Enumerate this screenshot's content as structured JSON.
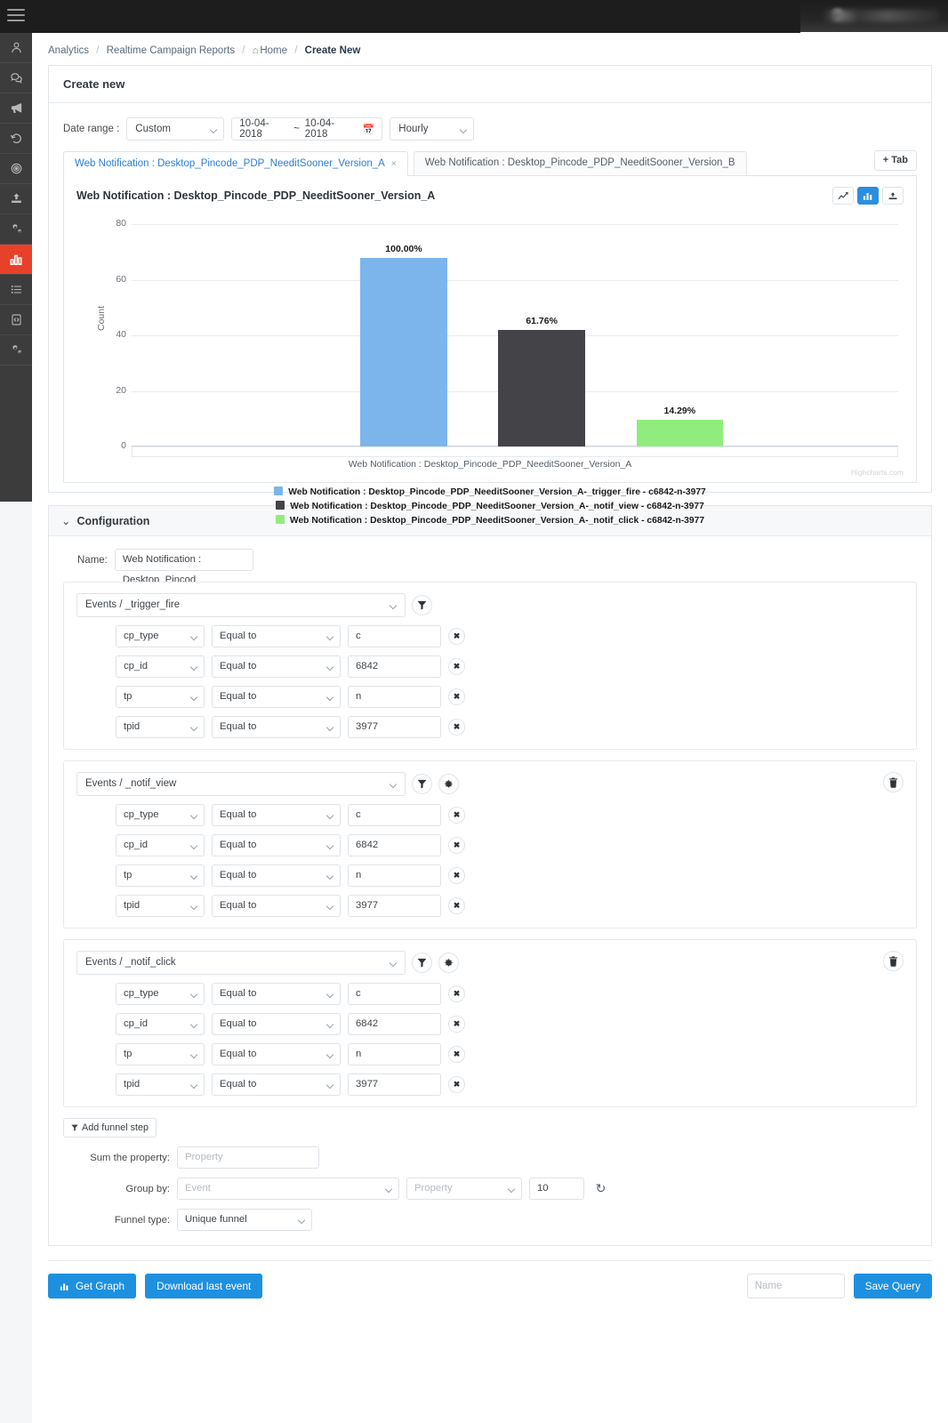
{
  "topbar": {
    "menu_icon": "hamburger-menu-icon",
    "user_area": "user-account-blurred"
  },
  "sidebar": {
    "items": [
      {
        "icon": "user-icon",
        "name": "users",
        "active": false
      },
      {
        "icon": "chat-icon",
        "name": "messages",
        "active": false
      },
      {
        "icon": "megaphone-icon",
        "name": "campaigns",
        "active": false
      },
      {
        "icon": "history-icon",
        "name": "history",
        "active": false
      },
      {
        "icon": "target-icon",
        "name": "targeting",
        "active": false
      },
      {
        "icon": "upload-icon",
        "name": "upload",
        "active": false
      },
      {
        "icon": "gears-icon",
        "name": "settings",
        "active": false
      },
      {
        "icon": "bar-chart-icon",
        "name": "analytics",
        "active": true
      },
      {
        "icon": "list-icon",
        "name": "lists",
        "active": false
      },
      {
        "icon": "code-file-icon",
        "name": "code",
        "active": false
      },
      {
        "icon": "gears-icon",
        "name": "advanced-settings",
        "active": false
      }
    ]
  },
  "breadcrumb": {
    "items": [
      "Analytics",
      "Realtime Campaign Reports",
      "Home",
      "Create New"
    ],
    "home_icon": "⌂"
  },
  "panel": {
    "title": "Create new"
  },
  "daterange": {
    "label": "Date range :",
    "preset": "Custom",
    "start": "10-04-2018",
    "end": "10-04-2018",
    "separator": "~",
    "calendar_icon": "calendar-icon",
    "granularity": "Hourly"
  },
  "tabs": {
    "items": [
      {
        "label": "Web Notification : Desktop_Pincode_PDP_NeeditSooner_Version_A",
        "active": true,
        "closable": true
      },
      {
        "label": "Web Notification : Desktop_Pincode_PDP_NeeditSooner_Version_B",
        "active": false,
        "closable": false
      }
    ],
    "add_label": "+ Tab",
    "close_glyph": "×"
  },
  "chart_card": {
    "title": "Web Notification : Desktop_Pincode_PDP_NeeditSooner_Version_A",
    "tools": [
      {
        "icon": "line-chart-icon",
        "active": false
      },
      {
        "icon": "bar-chart-icon",
        "active": true
      },
      {
        "icon": "download-icon",
        "active": false
      }
    ],
    "credit": "Highcharts.com"
  },
  "chart_data": {
    "type": "bar",
    "title": "Web Notification : Desktop_Pincode_PDP_NeeditSooner_Version_A",
    "xlabel": "Web Notification : Desktop_Pincode_PDP_NeeditSooner_Version_A",
    "ylabel": "Count",
    "ylim": [
      0,
      80
    ],
    "yticks": [
      0,
      20,
      40,
      60,
      80
    ],
    "grid": true,
    "legend_position": "bottom",
    "categories": [
      "Web Notification : Desktop_Pincode_PDP_NeeditSooner_Version_A"
    ],
    "series": [
      {
        "name": "Web Notification : Desktop_Pincode_PDP_NeeditSooner_Version_A-_trigger_fire - c6842-n-3977",
        "color": "#7cb5ec",
        "values": [
          68
        ],
        "data_label": "100.00%"
      },
      {
        "name": "Web Notification : Desktop_Pincode_PDP_NeeditSooner_Version_A-_notif_view - c6842-n-3977",
        "color": "#434348",
        "values": [
          42
        ],
        "data_label": "61.76%"
      },
      {
        "name": "Web Notification : Desktop_Pincode_PDP_NeeditSooner_Version_A-_notif_click - c6842-n-3977",
        "color": "#90ed7d",
        "values": [
          9.7
        ],
        "data_label": "14.29%"
      }
    ]
  },
  "configuration": {
    "title": "Configuration",
    "chevron": "⌄",
    "name_label": "Name:",
    "name_value": "Web Notification : Desktop_Pincod",
    "filter_icon": "filter-icon",
    "gear_icon": "gear-icon",
    "trash_icon": "trash-icon",
    "remove_glyph": "✖",
    "blocks": [
      {
        "event": "Events / _trigger_fire",
        "has_gear": false,
        "has_trash": false,
        "filters": [
          {
            "property": "cp_type",
            "operator": "Equal to",
            "value": "c"
          },
          {
            "property": "cp_id",
            "operator": "Equal to",
            "value": "6842"
          },
          {
            "property": "tp",
            "operator": "Equal to",
            "value": "n"
          },
          {
            "property": "tpid",
            "operator": "Equal to",
            "value": "3977"
          }
        ]
      },
      {
        "event": "Events / _notif_view",
        "has_gear": true,
        "has_trash": true,
        "filters": [
          {
            "property": "cp_type",
            "operator": "Equal to",
            "value": "c"
          },
          {
            "property": "cp_id",
            "operator": "Equal to",
            "value": "6842"
          },
          {
            "property": "tp",
            "operator": "Equal to",
            "value": "n"
          },
          {
            "property": "tpid",
            "operator": "Equal to",
            "value": "3977"
          }
        ]
      },
      {
        "event": "Events / _notif_click",
        "has_gear": true,
        "has_trash": true,
        "filters": [
          {
            "property": "cp_type",
            "operator": "Equal to",
            "value": "c"
          },
          {
            "property": "cp_id",
            "operator": "Equal to",
            "value": "6842"
          },
          {
            "property": "tp",
            "operator": "Equal to",
            "value": "n"
          },
          {
            "property": "tpid",
            "operator": "Equal to",
            "value": "3977"
          }
        ]
      }
    ],
    "add_funnel_step": "Add funnel step",
    "sum_property_label": "Sum the property:",
    "sum_property_placeholder": "Property",
    "group_by_label": "Group by:",
    "group_by_event_placeholder": "Event",
    "group_by_property_placeholder": "Property",
    "group_by_limit": "10",
    "reload_icon": "reset-icon",
    "funnel_type_label": "Funnel type:",
    "funnel_type_value": "Unique funnel"
  },
  "footer": {
    "get_graph": "Get Graph",
    "get_graph_icon": "chart-icon",
    "download_last_event": "Download last event",
    "name_placeholder": "Name",
    "save_query": "Save Query"
  },
  "colors": {
    "accent": "#1e90e0",
    "sidebar_active": "#e8412a",
    "series_1": "#7cb5ec",
    "series_2": "#434348",
    "series_3": "#90ed7d"
  }
}
